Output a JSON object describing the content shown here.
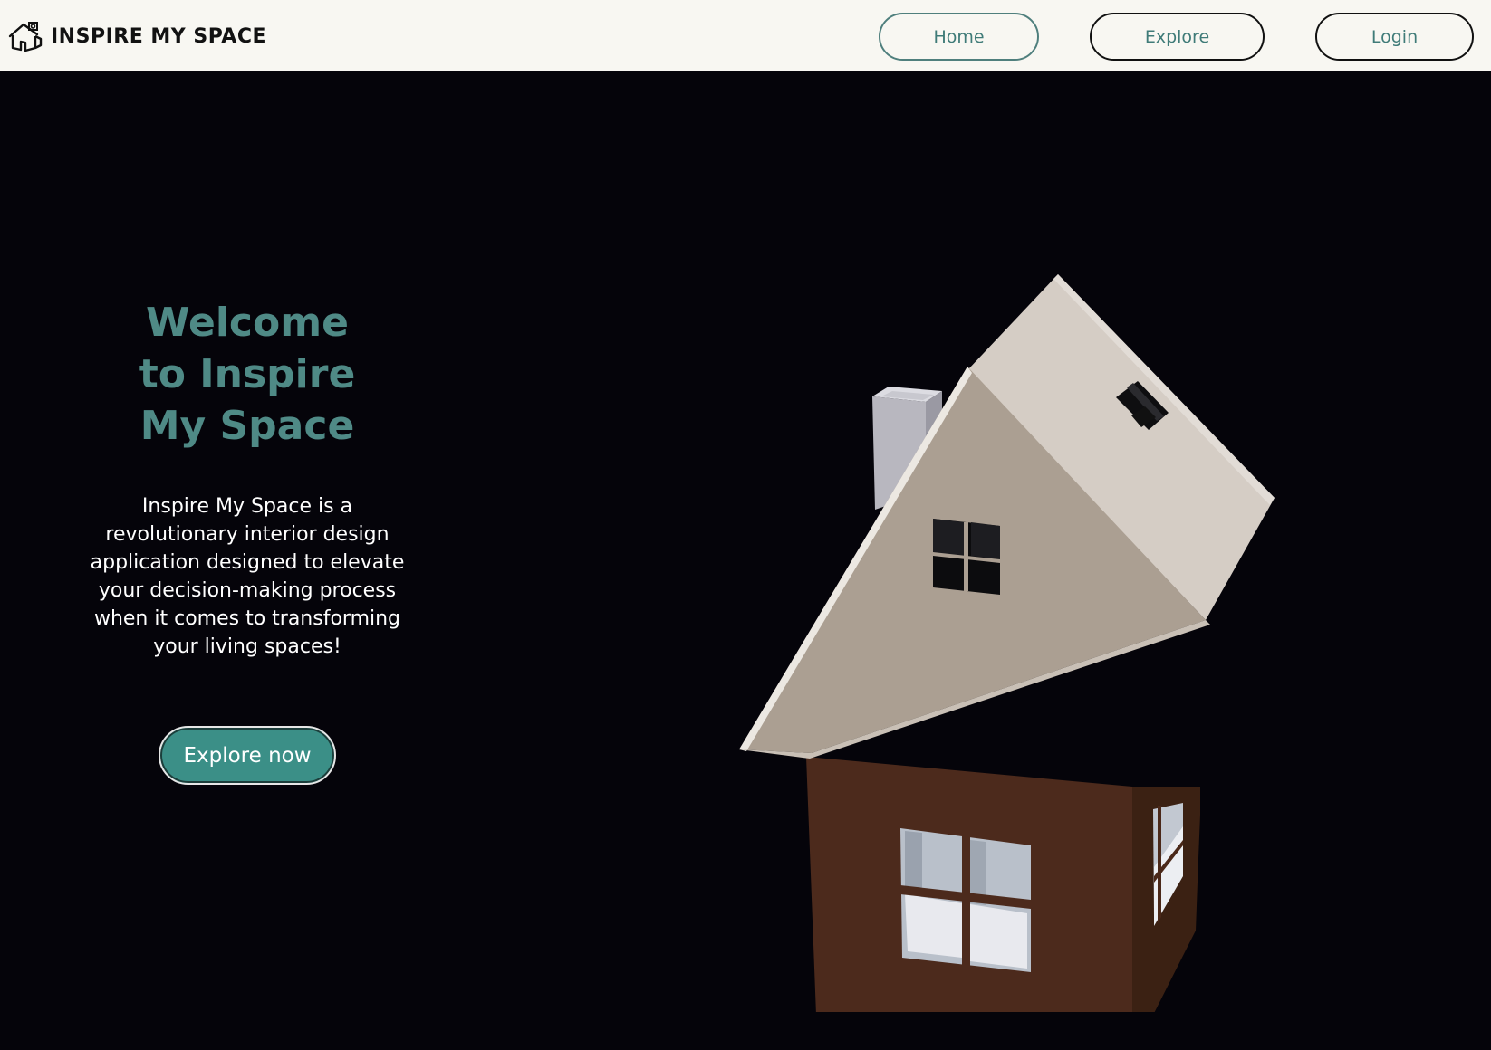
{
  "navbar": {
    "brand_name": "INSPIRE MY SPACE",
    "brand_icon": "house-logo-icon",
    "links": {
      "home": "Home",
      "explore": "Explore",
      "login": "Login"
    }
  },
  "hero": {
    "title_line1": "Welcome",
    "title_line2": "to Inspire",
    "title_line3": "My Space",
    "description": "Inspire My Space is a revolutionary interior design application designed to elevate your decision-making process when it comes to transforming your living spaces!",
    "cta_label": "Explore now"
  },
  "colors": {
    "navbar_bg": "#f8f7f2",
    "page_bg": "#05040a",
    "accent_teal": "#3b8f87",
    "title_teal": "#4f8a86",
    "house_wall": "#4c2a1c",
    "house_roof_light": "#d5cdc5",
    "house_gable": "#ab9f92"
  }
}
